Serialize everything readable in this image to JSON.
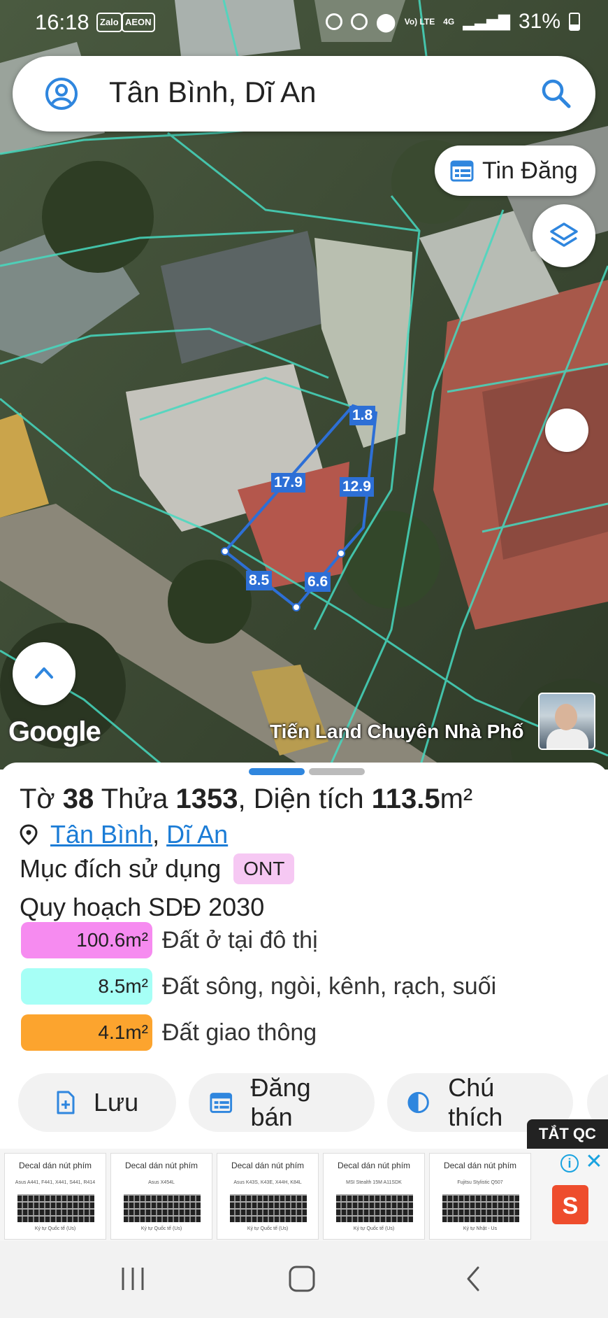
{
  "status_bar": {
    "time": "16:18",
    "app_icons": [
      "Zalo",
      "AEON"
    ],
    "network": "Vo) LTE",
    "signal": "4G",
    "battery": "31%"
  },
  "search": {
    "value": "Tân Bình, Dĩ An"
  },
  "map": {
    "tin_dang_label": "Tin Đăng",
    "google_label": "Google",
    "channel_name": "Tiến Land Chuyên Nhà Phố",
    "segments": [
      "1.8",
      "17.9",
      "12.9",
      "8.5",
      "6.6"
    ],
    "boundary_color": "#2d6fd6",
    "parcel_line_color": "#46d9c0"
  },
  "parcel": {
    "sheet_prefix": "Tờ",
    "sheet_no": "38",
    "lot_prefix": "Thửa",
    "lot_no": "1353",
    "area_prefix": ", Diện tích",
    "area_value": "113.5",
    "area_unit": "m²",
    "ward": "Tân Bình",
    "separator": ",",
    "city": "Dĩ An",
    "purpose_label": "Mục đích sử dụng",
    "purpose_code": "ONT",
    "plan_title": "Quy hoạch SDĐ 2030",
    "zones": [
      {
        "amount": "100.6m²",
        "name": "Đất ở tại đô thị",
        "color": "#f68bf0"
      },
      {
        "amount": "8.5m²",
        "name": "Đất sông, ngòi, kênh, rạch, suối",
        "color": "#a6fff6"
      },
      {
        "amount": "4.1m²",
        "name": "Đất giao thông",
        "color": "#fca42e"
      }
    ]
  },
  "actions": {
    "save": "Lưu",
    "post": "Đăng bán",
    "legend": "Chú thích"
  },
  "ads": {
    "off_label": "TẮT QC",
    "cards": [
      {
        "title": "Decal dán nút phím",
        "model": "Asus A441, F441, X441, S441, R414",
        "footer": "Ký tự Quốc tế (Us)"
      },
      {
        "title": "Decal dán nút phím",
        "model": "Asus X454L",
        "footer": "Ký tự Quốc tế (Us)"
      },
      {
        "title": "Decal dán nút phím",
        "model": "Asus K43S, K43E, X44H, K84L",
        "footer": "Ký tự Quốc tế (Us)"
      },
      {
        "title": "Decal dán nút phím",
        "model": "MSI Stealth 15M A11SDK",
        "footer": "Ký tự Quốc tế (Us)"
      },
      {
        "title": "Decal dán nút phím",
        "model": "Fujitsu Stylistic Q507",
        "footer": "Ký tự Nhật - Us"
      }
    ]
  }
}
